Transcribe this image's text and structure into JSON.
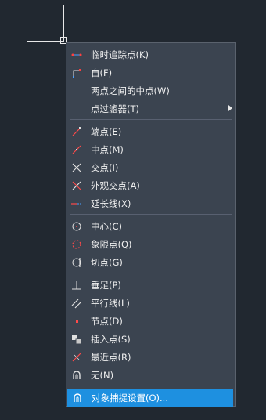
{
  "menu": {
    "groups": [
      [
        {
          "label": "临时追踪点(K)",
          "icon": "temporary-track-point-icon"
        },
        {
          "label": "自(F)",
          "icon": "from-icon"
        },
        {
          "label": "两点之间的中点(W)",
          "icon": ""
        },
        {
          "label": "点过滤器(T)",
          "icon": "",
          "submenu": true
        }
      ],
      [
        {
          "label": "端点(E)",
          "icon": "endpoint-icon"
        },
        {
          "label": "中点(M)",
          "icon": "midpoint-icon"
        },
        {
          "label": "交点(I)",
          "icon": "intersection-icon"
        },
        {
          "label": "外观交点(A)",
          "icon": "apparent-intersection-icon"
        },
        {
          "label": "延长线(X)",
          "icon": "extension-icon"
        }
      ],
      [
        {
          "label": "中心(C)",
          "icon": "center-icon"
        },
        {
          "label": "象限点(Q)",
          "icon": "quadrant-icon"
        },
        {
          "label": "切点(G)",
          "icon": "tangent-icon"
        }
      ],
      [
        {
          "label": "垂足(P)",
          "icon": "perpendicular-icon"
        },
        {
          "label": "平行线(L)",
          "icon": "parallel-icon"
        },
        {
          "label": "节点(D)",
          "icon": "node-icon"
        },
        {
          "label": "插入点(S)",
          "icon": "insertion-icon"
        },
        {
          "label": "最近点(R)",
          "icon": "nearest-icon"
        },
        {
          "label": "无(N)",
          "icon": "none-icon"
        }
      ],
      [
        {
          "label": "对象捕捉设置(O)...",
          "icon": "osnap-settings-icon",
          "highlighted": true
        }
      ]
    ]
  }
}
